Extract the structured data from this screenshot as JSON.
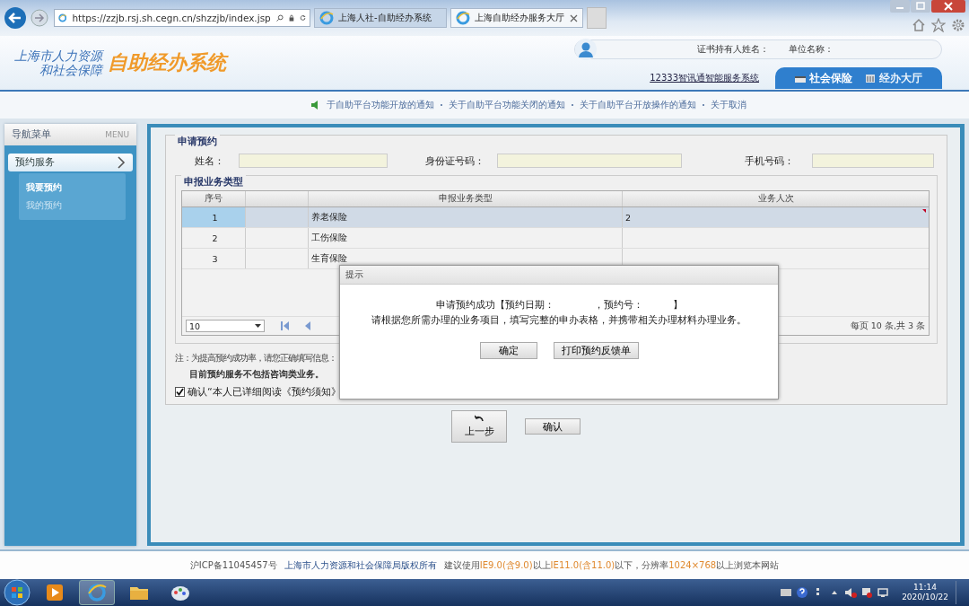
{
  "browser": {
    "address": "https://zzjb.rsj.sh.cegn.cn/shzzjb/index.jsp",
    "tabs": [
      {
        "label": "上海人社-自助经办系统",
        "selected": false
      },
      {
        "label": "上海自助经办服务大厅",
        "selected": true
      }
    ]
  },
  "header": {
    "logo_line_1": "上海市人力资源",
    "logo_line_2": "和社会保障",
    "system_name": "自助经办系统",
    "user_fields": [
      "证书持有人姓名：",
      "单位名称："
    ],
    "service_link": "12333智讯通智能服务系统",
    "tabs": [
      {
        "label": "社会保险",
        "selected": true
      },
      {
        "label": "经办大厅",
        "selected": false
      }
    ]
  },
  "notices": [
    "于自助平台功能开放的通知",
    "关于自助平台功能关闭的通知",
    "关于自助平台开放操作的通知",
    "关于取消"
  ],
  "sidebar": {
    "title": "导航菜单",
    "title_en": "MENU",
    "items": [
      {
        "label": "预约服务",
        "expanded": true,
        "children": [
          {
            "label": "我要预约",
            "selected": true
          },
          {
            "label": "我的预约",
            "selected": false
          }
        ]
      }
    ]
  },
  "form": {
    "section_title": "申请预约",
    "fields": [
      {
        "label": "姓名："
      },
      {
        "label": "身份证号码："
      },
      {
        "label": "手机号码："
      }
    ],
    "table_title": "申报业务类型",
    "table": {
      "columns": [
        "序号",
        "申报业务类型",
        "业务人次"
      ],
      "rows": [
        {
          "cells": [
            "1",
            "养老保险",
            "2"
          ],
          "selected": true,
          "modified": true
        },
        {
          "cells": [
            "2",
            "工伤保险",
            ""
          ],
          "selected": false,
          "modified": false
        },
        {
          "cells": [
            "3",
            "生育保险",
            ""
          ],
          "selected": false,
          "modified": false
        }
      ],
      "page_size": "10",
      "summary": "每页 10 条,共 3 条"
    },
    "note_lines": [
      "注：为提高预约成功率，请您正确填写信息：",
      "目前预约服务不包括咨询类业务。"
    ],
    "confirm": {
      "label": "确认“本人已详细阅读《预约须知》",
      "checked": true
    },
    "buttons": [
      {
        "label": "上一步",
        "kind": "back"
      },
      {
        "label": "确认",
        "kind": "plain"
      }
    ]
  },
  "dialog": {
    "title": "提示",
    "lines": [
      "申请预约成功【预约日期：　　　　，预约号：　　　】",
      "请根据您所需办理的业务项目，填写完整的申办表格，并携带相关办理材料办理业务。"
    ],
    "buttons": [
      "确定",
      "打印预约反馈单"
    ]
  },
  "footer": {
    "icp": "沪ICP备11045457号",
    "copyright": "上海市人力资源和社会保障局版权所有",
    "advice": [
      {
        "text": "建议使用",
        "highlight": false
      },
      {
        "text": "IE9.0(含9.0)",
        "highlight": true
      },
      {
        "text": "以上",
        "highlight": false
      },
      {
        "text": "IE11.0(含11.0)",
        "highlight": true
      },
      {
        "text": "以下，分辨率",
        "highlight": false
      },
      {
        "text": "1024×768",
        "highlight": true
      },
      {
        "text": "以上浏览本网站",
        "highlight": false
      }
    ]
  },
  "taskbar": {
    "time": "11:14",
    "date": "2020/10/22"
  }
}
